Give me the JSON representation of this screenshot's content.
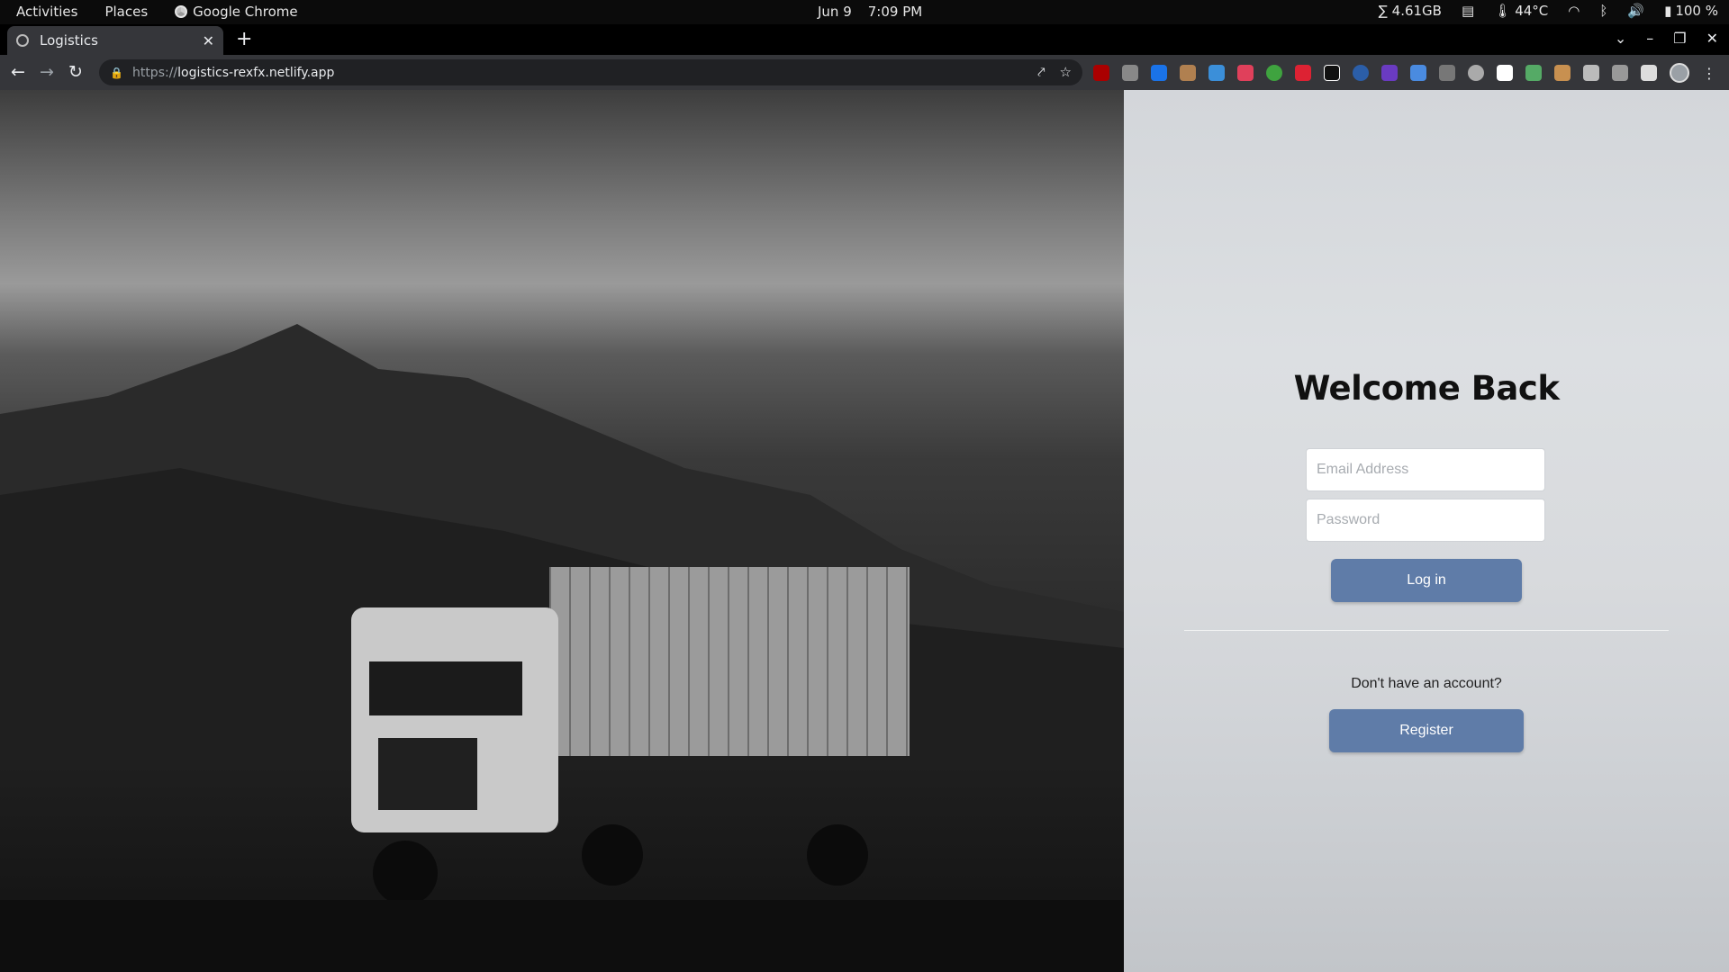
{
  "topbar": {
    "activities": "Activities",
    "places": "Places",
    "app_name": "Google Chrome",
    "date": "Jun 9",
    "time": "7:09 PM",
    "memory": "∑ 4.61GB",
    "temperature": "44°C",
    "battery": "100 %"
  },
  "browser": {
    "tab_title": "Logistics",
    "url_protocol": "https://",
    "url_host": "logistics-rexfx.netlify.app"
  },
  "login": {
    "heading": "Welcome Back",
    "email_placeholder": "Email Address",
    "password_placeholder": "Password",
    "login_label": "Log in",
    "no_account_text": "Don't have an account?",
    "register_label": "Register"
  },
  "colors": {
    "button": "#5f7ca8",
    "panel": "#d8dadd"
  }
}
